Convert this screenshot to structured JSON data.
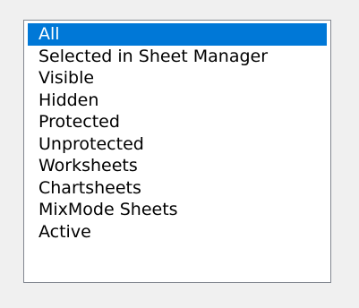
{
  "listbox": {
    "selected_index": 0,
    "items": [
      {
        "label": "All"
      },
      {
        "label": "Selected in Sheet Manager"
      },
      {
        "label": "Visible"
      },
      {
        "label": "Hidden"
      },
      {
        "label": "Protected"
      },
      {
        "label": "Unprotected"
      },
      {
        "label": "Worksheets"
      },
      {
        "label": "Chartsheets"
      },
      {
        "label": "MixMode Sheets"
      },
      {
        "label": "Active"
      }
    ]
  },
  "colors": {
    "selection": "#0078d7",
    "background": "#f0f0f0",
    "list_background": "#ffffff",
    "border": "#828790"
  }
}
